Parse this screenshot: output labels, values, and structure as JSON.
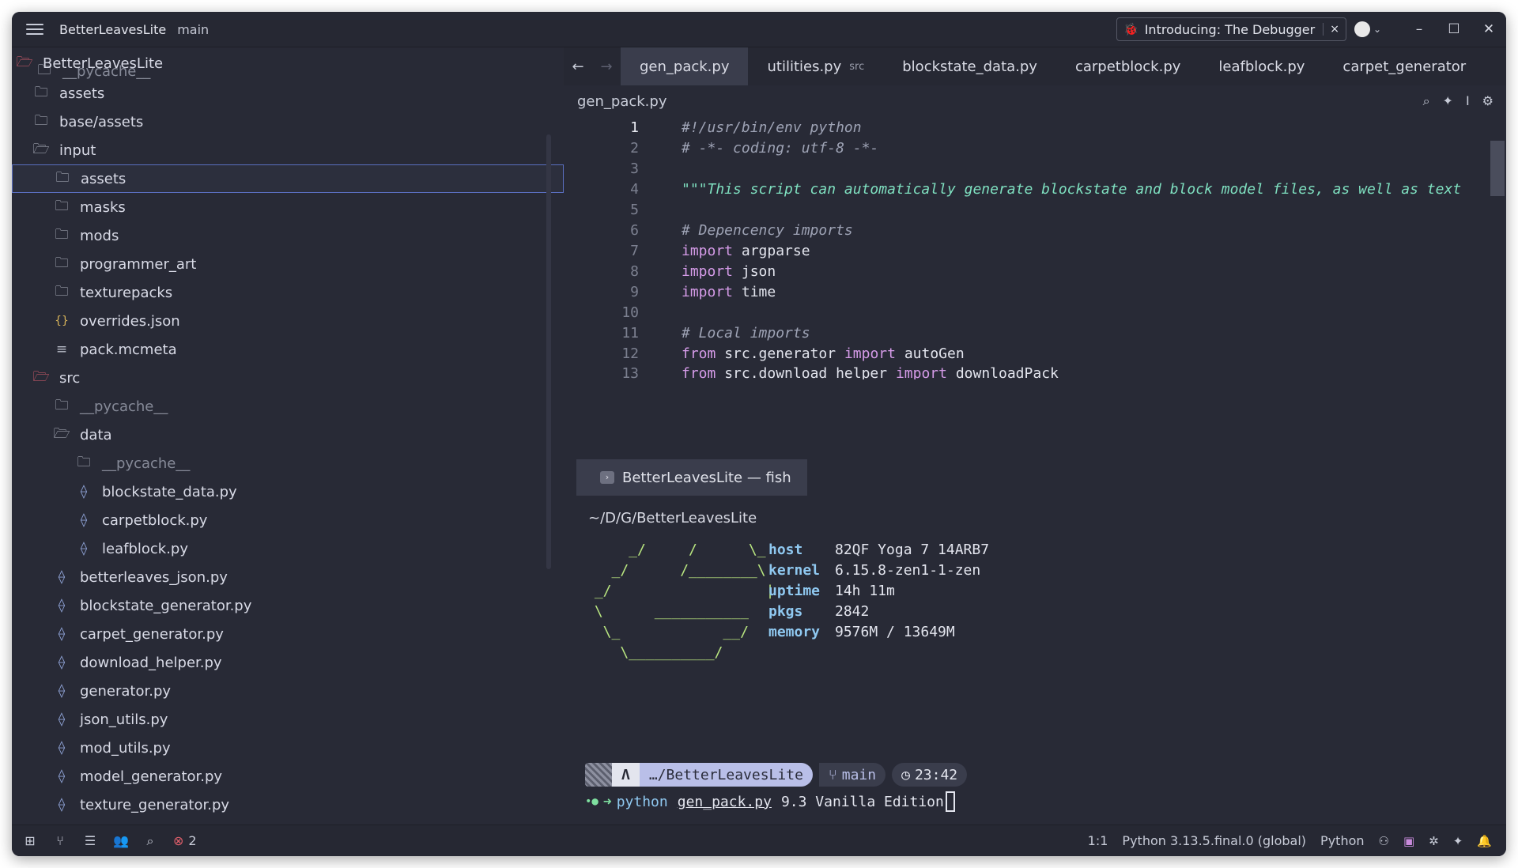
{
  "titlebar": {
    "project": "BetterLeavesLite",
    "branch": "main",
    "promo": "Introducing: The Debugger",
    "promo_close": "×",
    "minimize": "–",
    "maximize": "☐",
    "close": "✕"
  },
  "sidebar": {
    "root": "BetterLeavesLite",
    "hidden_top": "__pycache__",
    "items": [
      {
        "label": "assets",
        "icon": "folder"
      },
      {
        "label": "base/assets",
        "icon": "folder"
      },
      {
        "label": "input",
        "icon": "folder-open"
      },
      {
        "label": "assets",
        "icon": "folder"
      },
      {
        "label": "masks",
        "icon": "folder"
      },
      {
        "label": "mods",
        "icon": "folder"
      },
      {
        "label": "programmer_art",
        "icon": "folder"
      },
      {
        "label": "texturepacks",
        "icon": "folder"
      },
      {
        "label": "overrides.json",
        "icon": "json"
      },
      {
        "label": "pack.mcmeta",
        "icon": "text-file"
      },
      {
        "label": "src",
        "icon": "folder-open"
      },
      {
        "label": "__pycache__",
        "icon": "folder"
      },
      {
        "label": "data",
        "icon": "folder-open"
      },
      {
        "label": "__pycache__",
        "icon": "folder"
      },
      {
        "label": "blockstate_data.py",
        "icon": "python"
      },
      {
        "label": "carpetblock.py",
        "icon": "python"
      },
      {
        "label": "leafblock.py",
        "icon": "python"
      },
      {
        "label": "betterleaves_json.py",
        "icon": "python"
      },
      {
        "label": "blockstate_generator.py",
        "icon": "python"
      },
      {
        "label": "carpet_generator.py",
        "icon": "python"
      },
      {
        "label": "download_helper.py",
        "icon": "python"
      },
      {
        "label": "generator.py",
        "icon": "python"
      },
      {
        "label": "json_utils.py",
        "icon": "python"
      },
      {
        "label": "mod_utils.py",
        "icon": "python"
      },
      {
        "label": "model_generator.py",
        "icon": "python"
      },
      {
        "label": "texture_generator.py",
        "icon": "python"
      }
    ]
  },
  "tabs": [
    {
      "label": "gen_pack.py",
      "sub": ""
    },
    {
      "label": "utilities.py",
      "sub": "src"
    },
    {
      "label": "blockstate_data.py",
      "sub": ""
    },
    {
      "label": "carpetblock.py",
      "sub": ""
    },
    {
      "label": "leafblock.py",
      "sub": ""
    },
    {
      "label": "carpet_generator",
      "sub": ""
    }
  ],
  "editor": {
    "breadcrumb": "gen_pack.py",
    "lines": {
      "l1": "#!/usr/bin/env python",
      "l2": "# -*- coding: utf-8 -*-",
      "l4": "\"\"\"This script can automatically generate blockstate and block model files, as well as text",
      "l6": "# Depencency imports",
      "l7_kw": "import",
      "l7_mod": "argparse",
      "l8_kw": "import",
      "l8_mod": "json",
      "l9_kw": "import",
      "l9_mod": "time",
      "l11": "# Local imports",
      "l12_kw1": "from",
      "l12_mod": "src.generator",
      "l12_kw2": "import",
      "l12_name": "autoGen",
      "l13_kw1": "from",
      "l13_mod": "src.download_helper",
      "l13_kw2": "import",
      "l13_name": "downloadPack"
    }
  },
  "terminal": {
    "tab_title": "BetterLeavesLite — fish",
    "cwd": "~/D/G/BetterLeavesLite",
    "info": [
      {
        "key": "host",
        "value": "82QF Yoga 7 14ARB7"
      },
      {
        "key": "kernel",
        "value": "6.15.8-zen1-1-zen"
      },
      {
        "key": "uptime",
        "value": "14h 11m"
      },
      {
        "key": "pkgs",
        "value": "2842"
      },
      {
        "key": "memory",
        "value": "9576M / 13649M"
      }
    ],
    "prompt": {
      "arch": "Λ",
      "path": "…/BetterLeavesLite",
      "branch": "main",
      "time": "23:42"
    },
    "command": {
      "program": "python",
      "file": "gen_pack.py",
      "args": "9.3 Vanilla Edition"
    }
  },
  "statusbar": {
    "errors": "2",
    "position": "1:1",
    "interpreter": "Python 3.13.5.final.0 (global)",
    "language": "Python"
  }
}
